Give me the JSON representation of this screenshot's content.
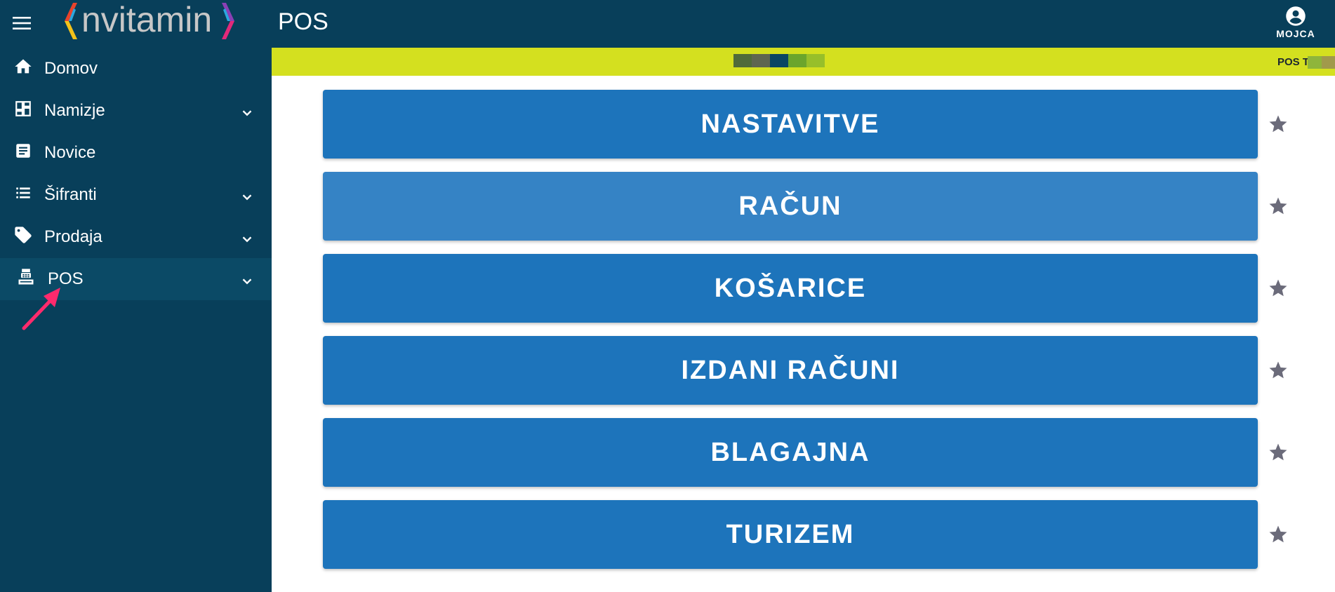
{
  "app": {
    "logo_text": "nvitamin",
    "page_title": "POS"
  },
  "user": {
    "name": "MOJCA",
    "icon": "account-circle-icon"
  },
  "sidebar": {
    "items": [
      {
        "label": "Domov",
        "icon": "home-icon",
        "expandable": false,
        "active": false
      },
      {
        "label": "Namizje",
        "icon": "dashboard-icon",
        "expandable": true,
        "active": false
      },
      {
        "label": "Novice",
        "icon": "article-icon",
        "expandable": false,
        "active": false
      },
      {
        "label": "Šifranti",
        "icon": "list-icon",
        "expandable": true,
        "active": false
      },
      {
        "label": "Prodaja",
        "icon": "tag-icon",
        "expandable": true,
        "active": false
      },
      {
        "label": "POS",
        "icon": "cash-register-icon",
        "expandable": true,
        "active": true
      }
    ]
  },
  "banner": {
    "label": "POS T",
    "background": "#d4e01f",
    "swatches": [
      "#4f6b3a",
      "#5e6650",
      "#0a4563",
      "#6ba52c",
      "#97bf2a"
    ]
  },
  "menu": {
    "buttons": [
      {
        "label": "NASTAVITVE"
      },
      {
        "label": "RAČUN"
      },
      {
        "label": "KOŠARICE"
      },
      {
        "label": "IZDANI RAČUNI"
      },
      {
        "label": "BLAGAJNA"
      },
      {
        "label": "TURIZEM"
      }
    ]
  },
  "colors": {
    "topbar": "#083f5a",
    "sidebar_active": "#0b4a66",
    "button": "#1d74bb",
    "button_hover": "#3583c5",
    "star": "#6b6b7a",
    "annotation_arrow": "#ff2a6d"
  }
}
